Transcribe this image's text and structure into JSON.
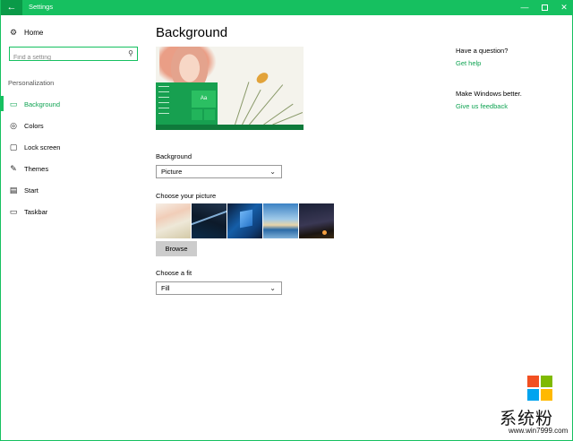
{
  "window": {
    "title": "Settings",
    "back_glyph": "←",
    "minimize_glyph": "—",
    "close_glyph": "✕"
  },
  "sidebar": {
    "home_label": "Home",
    "search_placeholder": "Find a setting",
    "section_label": "Personalization",
    "items": [
      {
        "label": "Background",
        "icon": "picture-icon",
        "glyph": "▭",
        "active": true
      },
      {
        "label": "Colors",
        "icon": "palette-icon",
        "glyph": "◎",
        "active": false
      },
      {
        "label": "Lock screen",
        "icon": "lock-screen-icon",
        "glyph": "▢",
        "active": false
      },
      {
        "label": "Themes",
        "icon": "themes-icon",
        "glyph": "✎",
        "active": false
      },
      {
        "label": "Start",
        "icon": "start-icon",
        "glyph": "▤",
        "active": false
      },
      {
        "label": "Taskbar",
        "icon": "taskbar-icon",
        "glyph": "▭",
        "active": false
      }
    ]
  },
  "main": {
    "title": "Background",
    "preview_tile_text": "Aa",
    "background_label": "Background",
    "background_value": "Picture",
    "choose_picture_label": "Choose your picture",
    "browse_label": "Browse",
    "fit_label": "Choose a fit",
    "fit_value": "Fill"
  },
  "right": {
    "question_title": "Have a question?",
    "help_link": "Get help",
    "better_title": "Make Windows better.",
    "feedback_link": "Give us feedback"
  },
  "colors": {
    "accent": "#16c060",
    "accent_text": "#0fa352",
    "titlebar": "#16c060"
  },
  "watermark": {
    "text": "系统粉",
    "url": "www.win7999.com"
  }
}
